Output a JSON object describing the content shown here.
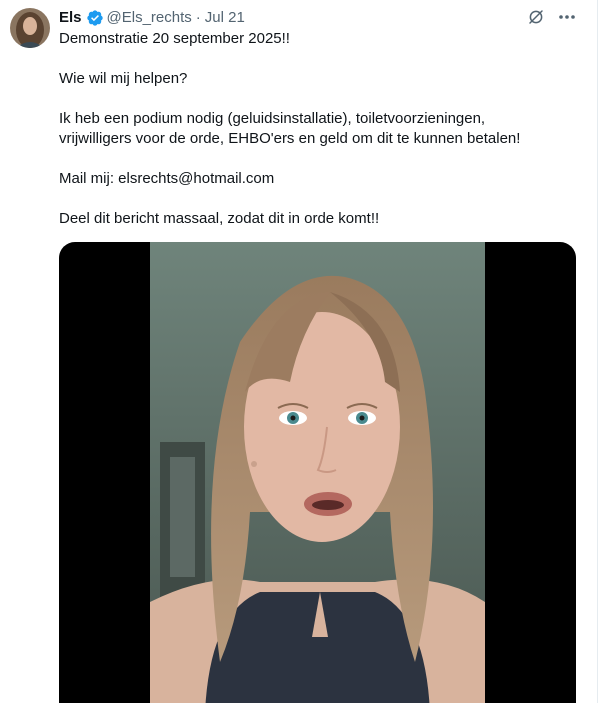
{
  "author": {
    "name": "Els",
    "handle": "@Els_rechts",
    "separator": "·",
    "date": "Jul 21",
    "verified_color": "#1d9bf0"
  },
  "icons": {
    "verified": "verified-badge-icon",
    "grok": "grok-icon",
    "more": "more-options-icon"
  },
  "tweet": {
    "paragraphs": [
      "Demonstratie 20 september 2025!!",
      "Wie wil mij helpen?",
      "Ik heb een podium nodig (geluidsinstallatie), toiletvoorzieningen,\nvrijwilligers voor de orde, EHBO'ers en geld om dit te kunnen betalen!",
      "Mail mij: elsrechts@hotmail.com",
      "Deel dit bericht massaal, zodat dit in orde komt!!"
    ]
  },
  "colors": {
    "text": "#0f1419",
    "muted": "#536471",
    "media_background": "#000000"
  }
}
